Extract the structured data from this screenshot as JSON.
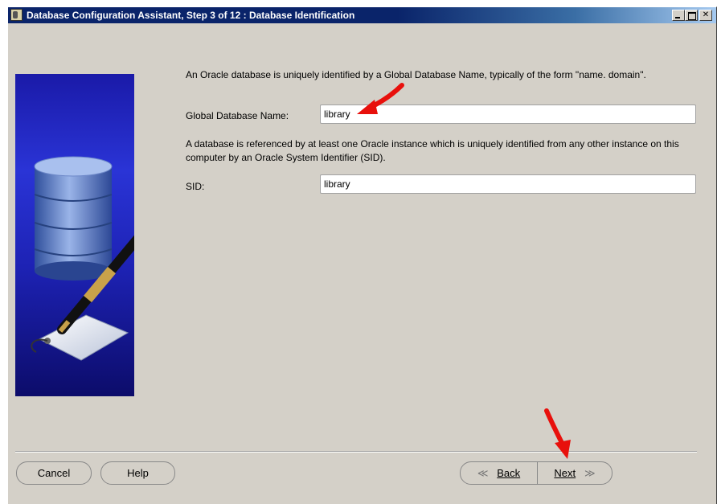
{
  "window": {
    "title": "Database Configuration Assistant, Step 3 of 12 : Database Identification",
    "controls": [
      "minimize-icon",
      "maximize-icon",
      "close-icon"
    ]
  },
  "main": {
    "intro_text": "An Oracle database is uniquely identified by a Global Database Name, typically of the form \"name. domain\".",
    "global_db_label": "Global Database Name:",
    "global_db_value": "library",
    "sid_text": "A database is referenced by at least one Oracle instance which is uniquely identified from any other instance on this computer by an Oracle System Identifier (SID).",
    "sid_label": "SID:",
    "sid_value": "library"
  },
  "footer": {
    "cancel_label": "Cancel",
    "help_label": "Help",
    "back_label": "Back",
    "next_label": "Next"
  },
  "colors": {
    "title_bar": "#0a246a",
    "dialog_bg": "#d4d0c8",
    "banner_blue": "#1d22b4",
    "annotation_arrow": "#e8100c"
  }
}
